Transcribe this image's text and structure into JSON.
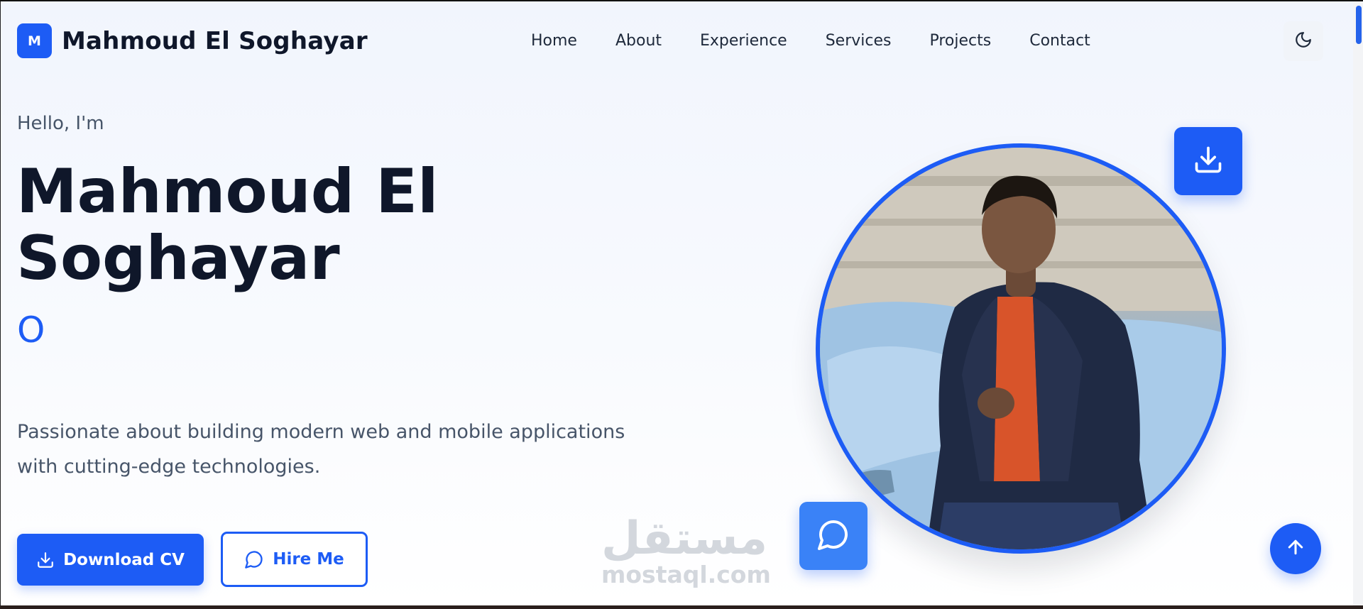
{
  "header": {
    "logo_letter": "M",
    "site_name": "Mahmoud El Soghayar",
    "nav": [
      "Home",
      "About",
      "Experience",
      "Services",
      "Projects",
      "Contact"
    ],
    "theme_icon": "moon-icon"
  },
  "hero": {
    "greeting": "Hello, I'm",
    "name": "Mahmoud El Soghayar",
    "typed_text": "O",
    "description": "Passionate about building modern web and mobile applications with cutting-edge technologies.",
    "primary_button": "Download CV",
    "secondary_button": "Hire Me"
  },
  "watermark": {
    "arabic": "مستقل",
    "latin": "mostaql.com"
  },
  "colors": {
    "accent": "#1d5cf5",
    "heading": "#0f172a",
    "body_text": "#475569"
  },
  "icons": {
    "download": "download-icon",
    "chat": "message-circle-icon",
    "scroll_top": "arrow-up-icon"
  }
}
